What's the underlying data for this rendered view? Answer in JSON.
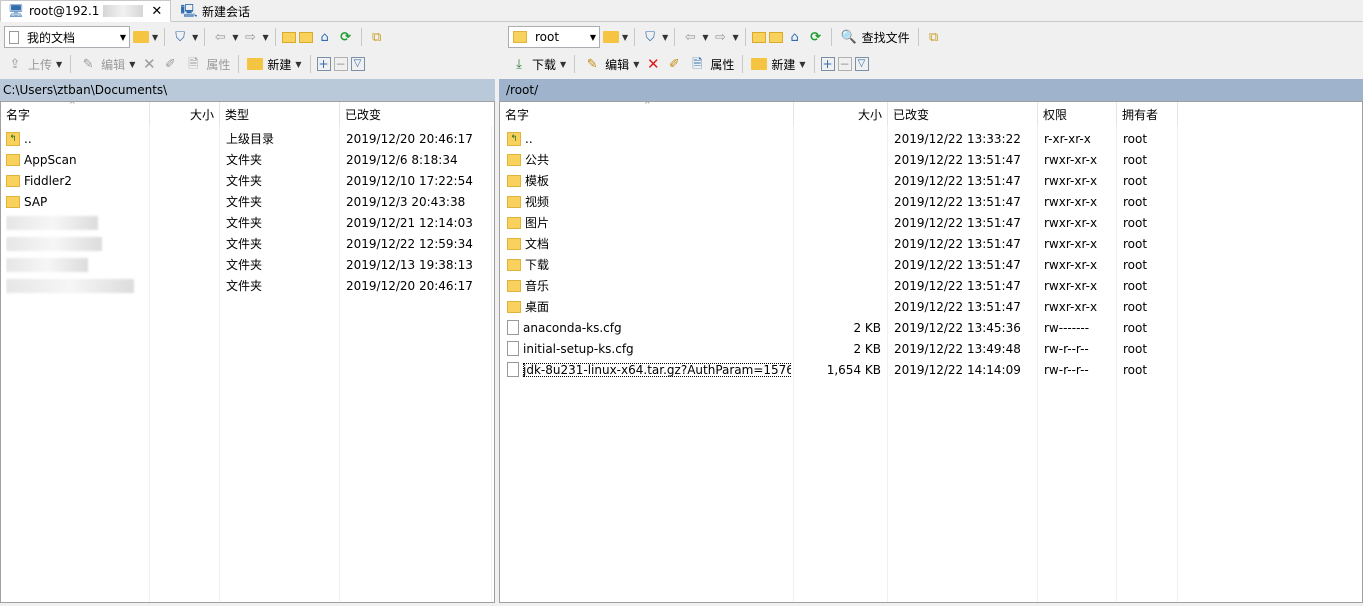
{
  "tabs": [
    {
      "label": "root@192.1",
      "close": "✕"
    },
    {
      "label": "新建会话"
    }
  ],
  "left": {
    "location": "我的文档",
    "toolbar": {
      "upload": "上传",
      "edit": "编辑",
      "props": "属性",
      "new": "新建"
    },
    "path": "C:\\Users\\ztban\\Documents\\",
    "columns": {
      "name": "名字",
      "size": "大小",
      "type": "类型",
      "changed": "已改变"
    },
    "rows": [
      {
        "name": "..",
        "type": "上级目录",
        "changed": "2019/12/20  20:46:17"
      },
      {
        "name": "AppScan",
        "type": "文件夹",
        "changed": "2019/12/6  8:18:34"
      },
      {
        "name": "Fiddler2",
        "type": "文件夹",
        "changed": "2019/12/10  17:22:54"
      },
      {
        "name": "SAP",
        "type": "文件夹",
        "changed": "2019/12/3  20:43:38"
      },
      {
        "name": "",
        "type": "文件夹",
        "changed": "2019/12/21  12:14:03"
      },
      {
        "name": "",
        "type": "文件夹",
        "changed": "2019/12/22  12:59:34"
      },
      {
        "name": "",
        "type": "文件夹",
        "changed": "2019/12/13  19:38:13"
      },
      {
        "name": "",
        "type": "文件夹",
        "changed": "2019/12/20  20:46:17"
      }
    ]
  },
  "right": {
    "location": "root",
    "toolbar": {
      "find": "查找文件",
      "download": "下载",
      "edit": "编辑",
      "props": "属性",
      "new": "新建"
    },
    "path": "/root/",
    "columns": {
      "name": "名字",
      "size": "大小",
      "changed": "已改变",
      "perms": "权限",
      "owner": "拥有者"
    },
    "rows": [
      {
        "name": "..",
        "size": "",
        "changed": "2019/12/22 13:33:22",
        "perms": "r-xr-xr-x",
        "owner": "root",
        "kind": "up"
      },
      {
        "name": "公共",
        "size": "",
        "changed": "2019/12/22 13:51:47",
        "perms": "rwxr-xr-x",
        "owner": "root",
        "kind": "folder"
      },
      {
        "name": "模板",
        "size": "",
        "changed": "2019/12/22 13:51:47",
        "perms": "rwxr-xr-x",
        "owner": "root",
        "kind": "folder"
      },
      {
        "name": "视频",
        "size": "",
        "changed": "2019/12/22 13:51:47",
        "perms": "rwxr-xr-x",
        "owner": "root",
        "kind": "folder"
      },
      {
        "name": "图片",
        "size": "",
        "changed": "2019/12/22 13:51:47",
        "perms": "rwxr-xr-x",
        "owner": "root",
        "kind": "folder"
      },
      {
        "name": "文档",
        "size": "",
        "changed": "2019/12/22 13:51:47",
        "perms": "rwxr-xr-x",
        "owner": "root",
        "kind": "folder"
      },
      {
        "name": "下载",
        "size": "",
        "changed": "2019/12/22 13:51:47",
        "perms": "rwxr-xr-x",
        "owner": "root",
        "kind": "folder"
      },
      {
        "name": "音乐",
        "size": "",
        "changed": "2019/12/22 13:51:47",
        "perms": "rwxr-xr-x",
        "owner": "root",
        "kind": "folder"
      },
      {
        "name": "桌面",
        "size": "",
        "changed": "2019/12/22 13:51:47",
        "perms": "rwxr-xr-x",
        "owner": "root",
        "kind": "folder"
      },
      {
        "name": "anaconda-ks.cfg",
        "size": "2 KB",
        "changed": "2019/12/22 13:45:36",
        "perms": "rw-------",
        "owner": "root",
        "kind": "file"
      },
      {
        "name": "initial-setup-ks.cfg",
        "size": "2 KB",
        "changed": "2019/12/22 13:49:48",
        "perms": "rw-r--r--",
        "owner": "root",
        "kind": "file"
      },
      {
        "name": "jdk-8u231-linux-x64.tar.gz?AuthParam=1576...",
        "size": "1,654 KB",
        "changed": "2019/12/22 14:14:09",
        "perms": "rw-r--r--",
        "owner": "root",
        "kind": "file"
      }
    ]
  },
  "icons": {
    "tab_session": "monitor-icon",
    "tab_new": "new-session-icon",
    "open_folder": "open-folder-icon",
    "filter": "filter-icon",
    "back": "back-arrow-icon",
    "forward": "forward-arrow-icon",
    "parent": "parent-dir-icon",
    "root": "root-dir-icon",
    "home": "home-icon",
    "refresh": "refresh-icon",
    "sync": "sync-browse-icon",
    "upload": "upload-icon",
    "download": "download-icon",
    "edit": "edit-icon",
    "delete": "delete-icon",
    "rename": "rename-icon",
    "properties": "properties-icon",
    "new": "new-icon",
    "plus": "plus-icon",
    "minus": "minus-icon",
    "check": "check-icon",
    "find": "find-files-icon"
  }
}
